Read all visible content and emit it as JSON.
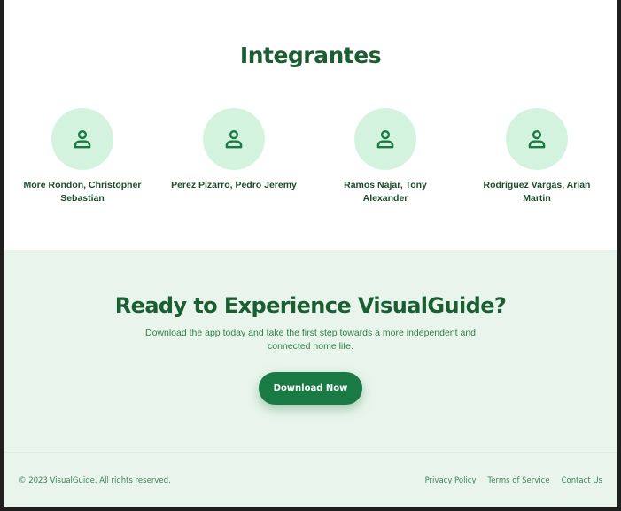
{
  "team": {
    "title": "Integrantes",
    "members": [
      {
        "name": "More Rondon, Christopher Sebastian",
        "icon": "user-icon"
      },
      {
        "name": "Perez Pizarro, Pedro Jeremy",
        "icon": "user-icon"
      },
      {
        "name": "Ramos Najar, Tony Alexander",
        "icon": "user-icon"
      },
      {
        "name": "Rodriguez Vargas, Arian Martin",
        "icon": "user-icon"
      }
    ]
  },
  "cta": {
    "title": "Ready to Experience VisualGuide?",
    "subtitle": "Download the app today and take the first step towards a more independent and connected home life.",
    "button_label": "Download Now"
  },
  "footer": {
    "copyright": "© 2023 VisualGuide. All rights reserved.",
    "links": [
      "Privacy Policy",
      "Terms of Service",
      "Contact Us"
    ]
  },
  "colors": {
    "primary": "#1b5e32",
    "button": "#1a7a43",
    "avatar_bg": "#d4f3df",
    "section_bg": "#e9f5ec"
  }
}
